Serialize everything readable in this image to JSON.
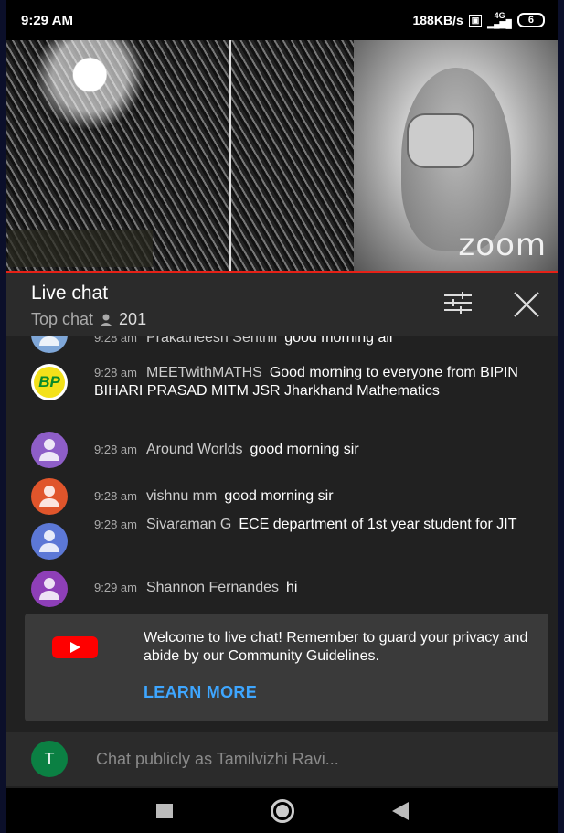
{
  "status_bar": {
    "time": "9:29 AM",
    "speed": "188KB/s",
    "network": "4G",
    "battery": "6"
  },
  "video": {
    "watermark": "zoom"
  },
  "chat_header": {
    "title": "Live chat",
    "mode": "Top chat",
    "viewers": "201"
  },
  "messages": [
    {
      "time": "9:28 am",
      "author": "Prakatheesh Senthil",
      "text": "good morning all",
      "avatar_color": "#7fa7d8"
    },
    {
      "time": "9:28 am",
      "author": "MEETwithMATHS",
      "text": "Good morning to everyone from BIPIN BIHARI PRASAD MITM JSR Jharkhand Mathematics",
      "avatar_text": "BP"
    },
    {
      "time": "9:28 am",
      "author": "Around Worlds",
      "text": "good morning sir",
      "avatar_color": "#8e5ec8"
    },
    {
      "time": "9:28 am",
      "author": "vishnu mm",
      "text": "good morning sir",
      "avatar_color": "#e0552b"
    },
    {
      "time": "9:28 am",
      "author": "Sivaraman G",
      "text": "ECE department of 1st year student for JIT",
      "avatar_color": "#5c78d6"
    },
    {
      "time": "9:29 am",
      "author": "Shannon Fernandes",
      "text": "hi",
      "avatar_color": "#8e3fb8"
    }
  ],
  "welcome": {
    "text": "Welcome to live chat! Remember to guard your privacy and abide by our Community Guidelines.",
    "learn_more": "LEARN MORE"
  },
  "input": {
    "avatar_letter": "T",
    "placeholder": "Chat publicly as Tamilvizhi Ravi..."
  },
  "colors": {
    "accent_blue": "#3ea6ff",
    "progress_red": "#e62117",
    "youtube_red": "#ff0000"
  }
}
